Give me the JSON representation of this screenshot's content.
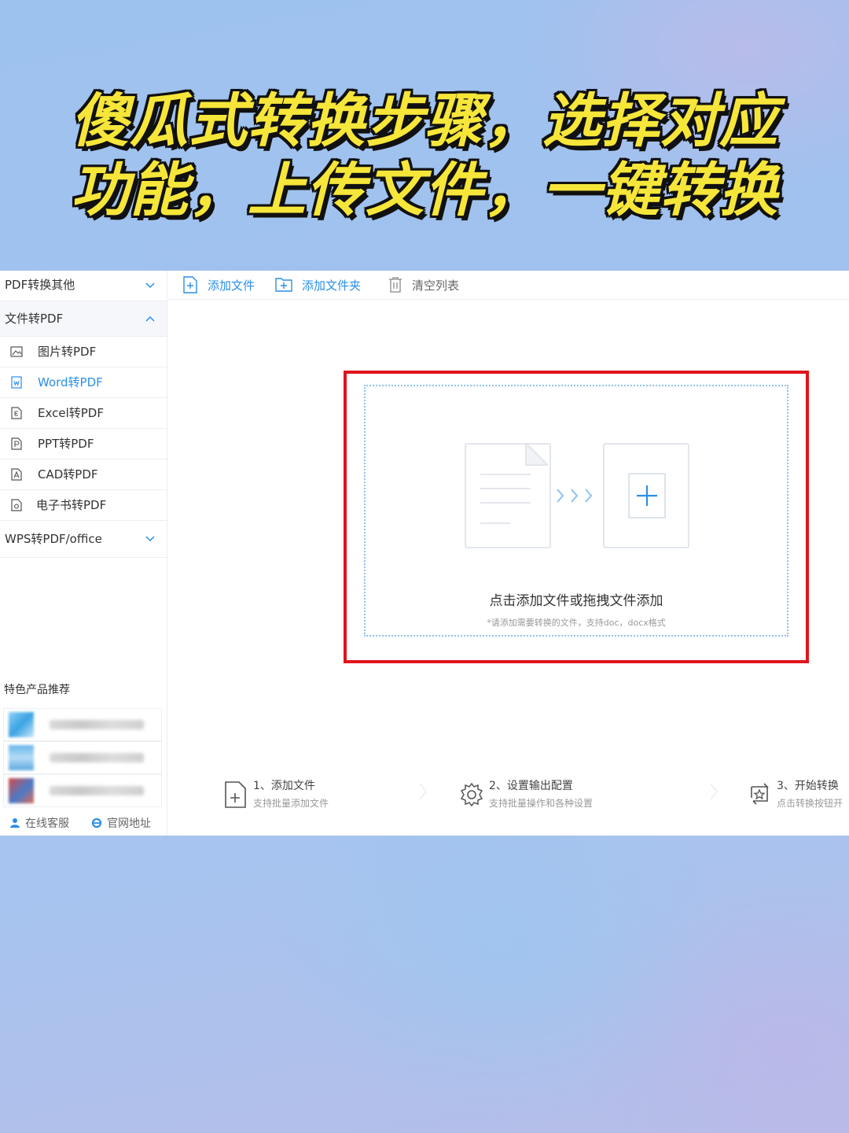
{
  "headline": {
    "line1": "傻瓜式转换步骤，选择对应",
    "line2": "功能，上传文件，一键转换",
    "color": "#f6e63a"
  },
  "sidebar": {
    "sections": [
      {
        "label": "PDF转换其他",
        "expanded": false
      },
      {
        "label": "文件转PDF",
        "expanded": true
      },
      {
        "label": "WPS转PDF/office",
        "expanded": false
      }
    ],
    "items": [
      {
        "label": "图片转PDF",
        "icon": "image-file-icon"
      },
      {
        "label": "Word转PDF",
        "icon": "word-file-icon",
        "active": true
      },
      {
        "label": "Excel转PDF",
        "icon": "excel-file-icon"
      },
      {
        "label": "PPT转PDF",
        "icon": "ppt-file-icon"
      },
      {
        "label": "CAD转PDF",
        "icon": "cad-file-icon"
      },
      {
        "label": "电子书转PDF",
        "icon": "ebook-file-icon"
      }
    ],
    "featured_title": "特色产品推荐",
    "links": {
      "service": "在线客服",
      "website": "官网地址"
    }
  },
  "toolbar": {
    "add_file": "添加文件",
    "add_folder": "添加文件夹",
    "clear_list": "清空列表",
    "accent": "#2b8ee8"
  },
  "dropzone": {
    "main_text": "点击添加文件或拖拽文件添加",
    "sub_text": "*请添加需要转换的文件，支持doc，docx格式",
    "highlight": "#e0141a"
  },
  "steps": [
    {
      "title": "1、添加文件",
      "sub": "支持批量添加文件",
      "icon": "add-file-icon"
    },
    {
      "title": "2、设置输出配置",
      "sub": "支持批量操作和各种设置",
      "icon": "gear-icon"
    },
    {
      "title": "3、开始转换",
      "sub": "点击转换按钮开",
      "icon": "convert-icon"
    }
  ]
}
